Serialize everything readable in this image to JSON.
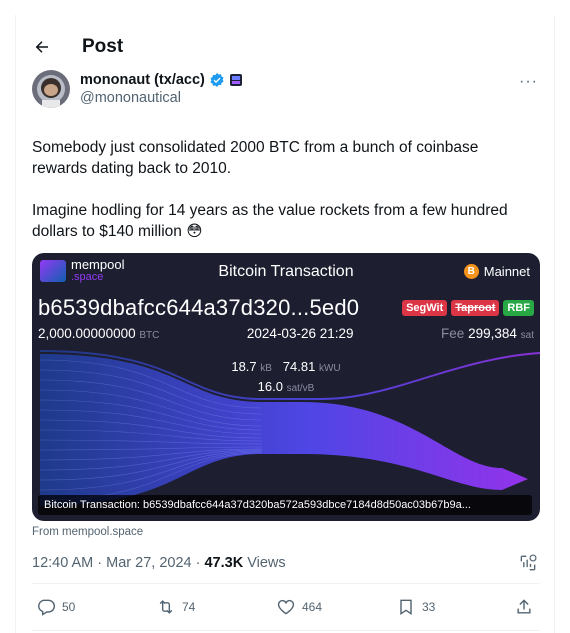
{
  "header": {
    "title": "Post"
  },
  "author": {
    "display_name": "mononaut (tx/acc)",
    "handle": "@mononautical"
  },
  "post": {
    "paragraphs": [
      "Somebody just consolidated 2000 BTC from a bunch of coinbase rewards dating back to 2010.",
      "Imagine hodling for 14 years as the value rockets from a few hundred dollars to $140 million 😳"
    ]
  },
  "card": {
    "logo_word1": "mempool",
    "logo_word2": ".space",
    "title": "Bitcoin Transaction",
    "network": "Mainnet",
    "network_icon": "B",
    "txid": "b6539dbafcc644a37d320...5ed0",
    "badges": [
      "SegWit",
      "Taproot",
      "RBF"
    ],
    "amount": "2,000.00000000",
    "amount_unit": "BTC",
    "datetime": "2024-03-26 21:29",
    "fee_label": "Fee",
    "fee": "299,384",
    "fee_unit": "sat",
    "size": "18.7",
    "size_unit": "kB",
    "weight": "74.81",
    "weight_unit": "kWU",
    "feerate": "16.0",
    "feerate_unit": "sat/vB",
    "caption": "Bitcoin Transaction: b6539dbafcc644a37d320ba572a593dbce7184d8d50ac03b67b9a...",
    "colors": {
      "bg": "#1d1f31",
      "flow_start": "#1e3a8a",
      "flow_end": "#9333ea"
    }
  },
  "source": "From mempool.space",
  "meta": {
    "time": "12:40 AM · Mar 27, 2024 · ",
    "views": "47.3K",
    "views_label": " Views"
  },
  "actions": {
    "replies": "50",
    "reposts": "74",
    "likes": "464",
    "bookmarks": "33"
  }
}
